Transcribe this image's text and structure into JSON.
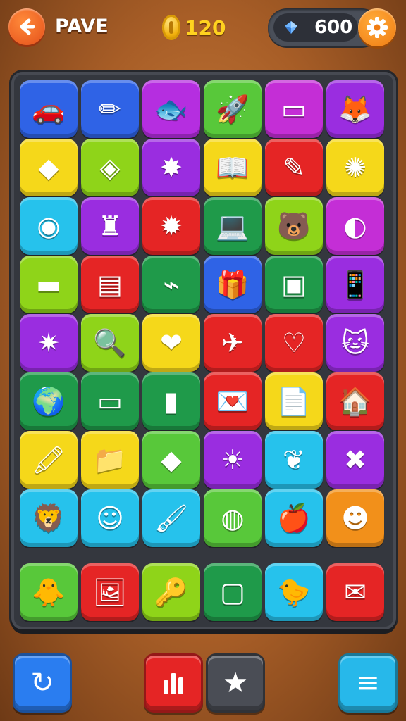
{
  "header": {
    "title": "PAVE",
    "coins": "120",
    "gems": "600"
  },
  "colors": {
    "blue": "#2f63e6",
    "yellow": "#f5d81a",
    "purple": "#9a2de0",
    "green": "#58c83a",
    "dkgreen": "#1f9a4a",
    "red": "#e52525",
    "cyan": "#26c2ec",
    "magenta": "#c42ed6",
    "lime": "#8fd419",
    "orange": "#f2901a"
  },
  "board": {
    "tiles": [
      {
        "color": "#2f63e6",
        "icon": "car-icon",
        "glyph": "🚗"
      },
      {
        "color": "#2f63e6",
        "icon": "crossed-pencils-icon",
        "glyph": "✏"
      },
      {
        "color": "#b52ee0",
        "icon": "fish-icon",
        "glyph": "🐟"
      },
      {
        "color": "#58c83a",
        "icon": "rocket-icon",
        "glyph": "🚀"
      },
      {
        "color": "#c42ed6",
        "icon": "monitor-icon",
        "glyph": "▭"
      },
      {
        "color": "#9a2de0",
        "icon": "fox-face-icon",
        "glyph": "🦊"
      },
      {
        "color": "#f5d81a",
        "icon": "gems-icon",
        "glyph": "◆"
      },
      {
        "color": "#8fd419",
        "icon": "candy-icon",
        "glyph": "◈"
      },
      {
        "color": "#9a2de0",
        "icon": "star-burst-icon",
        "glyph": "✸"
      },
      {
        "color": "#f5d81a",
        "icon": "open-book-icon",
        "glyph": "📖"
      },
      {
        "color": "#e52525",
        "icon": "pencil-icon",
        "glyph": "✎"
      },
      {
        "color": "#f5d81a",
        "icon": "gear-creature-icon",
        "glyph": "✺"
      },
      {
        "color": "#26c2ec",
        "icon": "ring-icon",
        "glyph": "◉"
      },
      {
        "color": "#9a2de0",
        "icon": "glove-icon",
        "glyph": "♜"
      },
      {
        "color": "#e52525",
        "icon": "sun-creature-icon",
        "glyph": "✹"
      },
      {
        "color": "#1f9a4a",
        "icon": "laptop-icon",
        "glyph": "💻"
      },
      {
        "color": "#8fd419",
        "icon": "bear-face-icon",
        "glyph": "🐻"
      },
      {
        "color": "#c42ed6",
        "icon": "robot-icon",
        "glyph": "◐"
      },
      {
        "color": "#8fd419",
        "icon": "ruler-icon",
        "glyph": "▬"
      },
      {
        "color": "#e52525",
        "icon": "window-icon",
        "glyph": "▤"
      },
      {
        "color": "#1f9a4a",
        "icon": "usb-stick-icon",
        "glyph": "⌁"
      },
      {
        "color": "#2f63e6",
        "icon": "gift-box-icon",
        "glyph": "🎁"
      },
      {
        "color": "#1f9a4a",
        "icon": "browser-icon",
        "glyph": "▣"
      },
      {
        "color": "#9a2de0",
        "icon": "phone-icon",
        "glyph": "📱"
      },
      {
        "color": "#9a2de0",
        "icon": "splat-icon",
        "glyph": "✷"
      },
      {
        "color": "#8fd419",
        "icon": "magnifier-icon",
        "glyph": "🔍"
      },
      {
        "color": "#f5d81a",
        "icon": "heart-icon",
        "glyph": "❤"
      },
      {
        "color": "#e52525",
        "icon": "paper-plane-icon",
        "glyph": "✈"
      },
      {
        "color": "#e52525",
        "icon": "heart-ring-icon",
        "glyph": "♡"
      },
      {
        "color": "#9a2de0",
        "icon": "cat-face-icon",
        "glyph": "🐱"
      },
      {
        "color": "#1f9a4a",
        "icon": "globe-icon",
        "glyph": "🌍"
      },
      {
        "color": "#1f9a4a",
        "icon": "bandage-icon",
        "glyph": "▭"
      },
      {
        "color": "#1f9a4a",
        "icon": "remote-icon",
        "glyph": "▮"
      },
      {
        "color": "#e52525",
        "icon": "heart-cards-icon",
        "glyph": "💌"
      },
      {
        "color": "#f5d81a",
        "icon": "document-icon",
        "glyph": "📄"
      },
      {
        "color": "#e52525",
        "icon": "house-icon",
        "glyph": "🏠"
      },
      {
        "color": "#f5d81a",
        "icon": "marker-icon",
        "glyph": "🖍"
      },
      {
        "color": "#f5d81a",
        "icon": "folder-icon",
        "glyph": "📁"
      },
      {
        "color": "#58c83a",
        "icon": "diamond-icon",
        "glyph": "◆"
      },
      {
        "color": "#9a2de0",
        "icon": "sun-badge-icon",
        "glyph": "☀"
      },
      {
        "color": "#26c2ec",
        "icon": "vine-icon",
        "glyph": "❦"
      },
      {
        "color": "#9a2de0",
        "icon": "crossed-swords-icon",
        "glyph": "✖"
      },
      {
        "color": "#26c2ec",
        "icon": "lion-face-icon",
        "glyph": "🦁"
      },
      {
        "color": "#26c2ec",
        "icon": "smiley-icon",
        "glyph": "☺"
      },
      {
        "color": "#26c2ec",
        "icon": "brush-icon",
        "glyph": "🖌"
      },
      {
        "color": "#58c83a",
        "icon": "donut-icon",
        "glyph": "◍"
      },
      {
        "color": "#26c2ec",
        "icon": "fruit-icon",
        "glyph": "🍎"
      },
      {
        "color": "#f2901a",
        "icon": "toaster-face-icon",
        "glyph": "☻"
      },
      {
        "color": "#58c83a",
        "icon": "duck-face-icon",
        "glyph": "🐥"
      },
      {
        "color": "#e52525",
        "icon": "picture-icon",
        "glyph": "🖼"
      },
      {
        "color": "#8fd419",
        "icon": "key-icon",
        "glyph": "🔑"
      },
      {
        "color": "#1f9a4a",
        "icon": "toast-icon",
        "glyph": "▢"
      },
      {
        "color": "#26c2ec",
        "icon": "chick-icon",
        "glyph": "🐤"
      },
      {
        "color": "#e52525",
        "icon": "envelope-icon",
        "glyph": "✉"
      }
    ]
  },
  "bottom": {
    "left": {
      "icon": "refresh-icon",
      "glyph": "↻"
    },
    "stats": {
      "icon": "bar-chart-icon",
      "glyph": "▮"
    },
    "star": {
      "icon": "star-icon",
      "glyph": "★"
    },
    "menu": {
      "icon": "menu-icon",
      "glyph": "≡"
    }
  }
}
